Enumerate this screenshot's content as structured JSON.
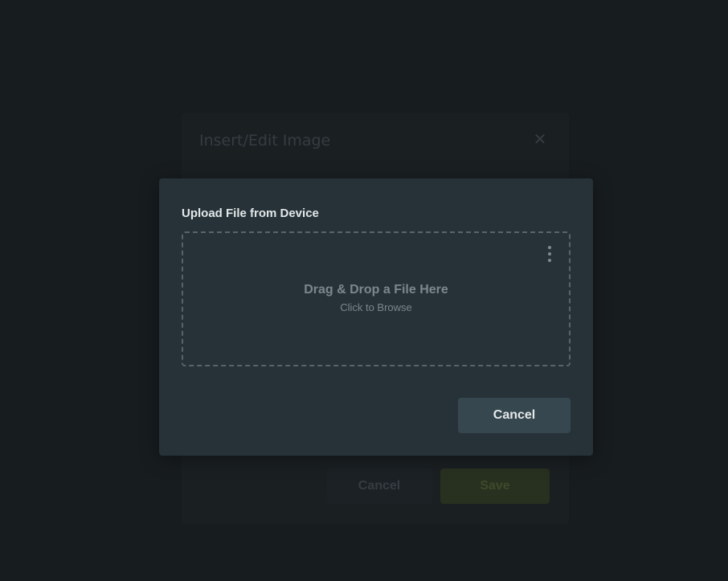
{
  "background": {
    "dialog_title": "Insert/Edit Image",
    "close_icon": "close-icon",
    "cancel_label": "Cancel",
    "save_label": "Save"
  },
  "upload_dialog": {
    "title": "Upload File from Device",
    "dropzone": {
      "primary_text": "Drag & Drop a File Here",
      "secondary_text": "Click to Browse",
      "menu_icon": "kebab-menu-icon"
    },
    "cancel_label": "Cancel"
  },
  "colors": {
    "overlay": "#171c1f",
    "dialog_bg": "#263238",
    "button_bg": "#37474f",
    "save_bg": "#283020"
  }
}
